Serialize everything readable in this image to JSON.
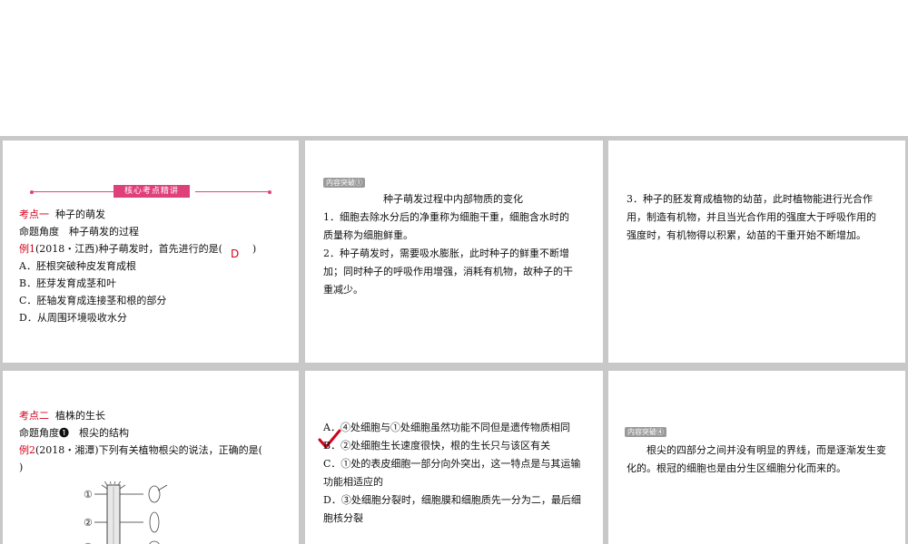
{
  "slide1": {
    "banner": "核心考点精讲",
    "section_title_prefix": "考点一",
    "section_title": "种子的萌发",
    "angle": "命题角度　种子萌发的过程",
    "example_prefix": "例1",
    "example_text": "(2018・江西)种子萌发时，首先进行的是(　　　)",
    "answer": "D",
    "options": [
      "A．胚根突破种皮发育成根",
      "B．胚芽发育成茎和叶",
      "C．胚轴发育成连接茎和根的部分",
      "D．从周围环境吸收水分"
    ]
  },
  "slide2": {
    "badge": "内容突破①",
    "title": "种子萌发过程中内部物质的变化",
    "lines": [
      "1．细胞去除水分后的净重称为细胞干重，细胞含水时的",
      "质量称为细胞鲜重。",
      "2．种子萌发时，需要吸水膨胀，此时种子的鲜重不断增",
      "加；同时种子的呼吸作用增强，消耗有机物，故种子的干",
      "重减少。"
    ]
  },
  "slide3": {
    "lines": [
      "3．种子的胚发育成植物的幼苗，此时植物能进行光合作",
      "用，制造有机物，并且当光合作用的强度大于呼吸作用的",
      "强度时，有机物得以积累，幼苗的干重开始不断增加。"
    ]
  },
  "slide4": {
    "section_title_prefix": "考点二",
    "section_title": "植株的生长",
    "angle": "命题角度❶　根尖的结构",
    "example_prefix": "例2",
    "example_text": "(2018・湘潭)下列有关植物根尖的说法，正确的是(",
    "example_text2": ")",
    "labels": [
      "①",
      "②",
      "③"
    ]
  },
  "slide5": {
    "lines": [
      "A．④处细胞与①处细胞虽然功能不同但是遗传物质相同",
      "B．②处细胞生长速度很快，根的生长只与该区有关",
      "C．①处的表皮细胞一部分向外突出，这一特点是与其运输",
      "功能相适应的",
      "D．③处细胞分裂时，细胞膜和细胞质先一分为二，最后细",
      "胞核分裂"
    ]
  },
  "slide6": {
    "badge": "内容突破④",
    "lines": [
      "根尖的四部分之间并没有明显的界线，而是逐渐发生变",
      "化的。根冠的细胞也是由分生区细胞分化而来的。"
    ]
  },
  "colors": {
    "accent": "#e0407a",
    "answer_red": "#d0021b",
    "band_gray": "#c8c8c8"
  }
}
